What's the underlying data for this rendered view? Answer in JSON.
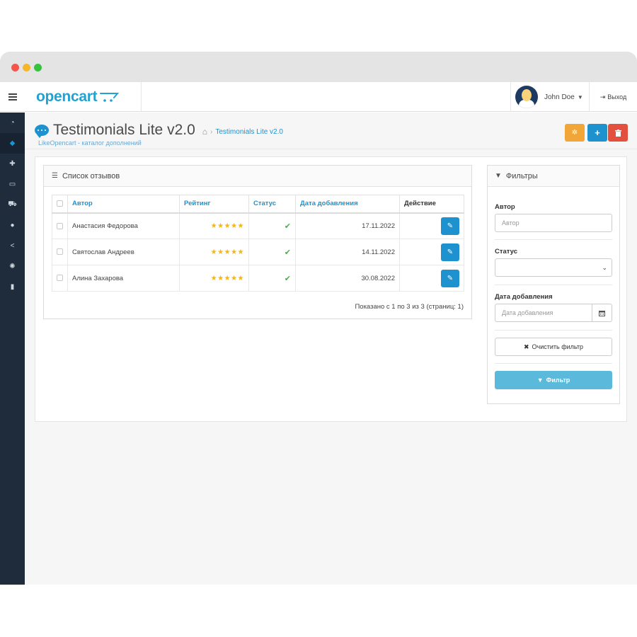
{
  "header": {
    "logo": "opencart",
    "user_name": "John Doe",
    "logout_label": "Выход"
  },
  "sidebar": {
    "items": [
      {
        "name": "dashboard",
        "icon": "dashboard-icon",
        "glyph": "◔"
      },
      {
        "name": "catalog",
        "icon": "tag-icon",
        "glyph": "◆",
        "active": true
      },
      {
        "name": "extensions",
        "icon": "puzzle-icon",
        "glyph": "✚"
      },
      {
        "name": "design",
        "icon": "monitor-icon",
        "glyph": "▭"
      },
      {
        "name": "sales",
        "icon": "cart-icon",
        "glyph": "⛟"
      },
      {
        "name": "customers",
        "icon": "user-icon",
        "glyph": "●"
      },
      {
        "name": "marketing",
        "icon": "share-icon",
        "glyph": "<"
      },
      {
        "name": "system",
        "icon": "gear-icon",
        "glyph": "✺"
      },
      {
        "name": "reports",
        "icon": "bar-chart-icon",
        "glyph": "▮"
      }
    ]
  },
  "page": {
    "title": "Testimonials Lite v2.0",
    "breadcrumb": "Testimonials Lite v2.0",
    "subtitle": "LikeOpencart - каталог дополнений"
  },
  "colors": {
    "accent": "#1e91cf",
    "warning": "#f3a638",
    "danger": "#e3503e",
    "sidebar": "#1f2c3b",
    "star": "#f3b518",
    "success": "#4cae4c"
  },
  "list": {
    "heading": "Список отзывов",
    "columns": {
      "author": "Автор",
      "rating": "Рейтинг",
      "status": "Статус",
      "date": "Дата добавления",
      "action": "Действие"
    },
    "rows": [
      {
        "author": "Анастасия Федорова",
        "rating": 5,
        "stars": "★★★★★",
        "status": "✔",
        "date": "17.11.2022"
      },
      {
        "author": "Святослав Андреев",
        "rating": 5,
        "stars": "★★★★★",
        "status": "✔",
        "date": "14.11.2022"
      },
      {
        "author": "Алина Захарова",
        "rating": 5,
        "stars": "★★★★★",
        "status": "✔",
        "date": "30.08.2022"
      }
    ],
    "pagination": "Показано с 1 по 3 из 3 (страниц: 1)"
  },
  "filters": {
    "heading": "Фильтры",
    "author_label": "Автор",
    "author_placeholder": "Автор",
    "status_label": "Статус",
    "status_value": "",
    "date_label": "Дата добавления",
    "date_placeholder": "Дата добавления",
    "clear_label": "Очистить фильтр",
    "filter_label": "Фильтр"
  }
}
